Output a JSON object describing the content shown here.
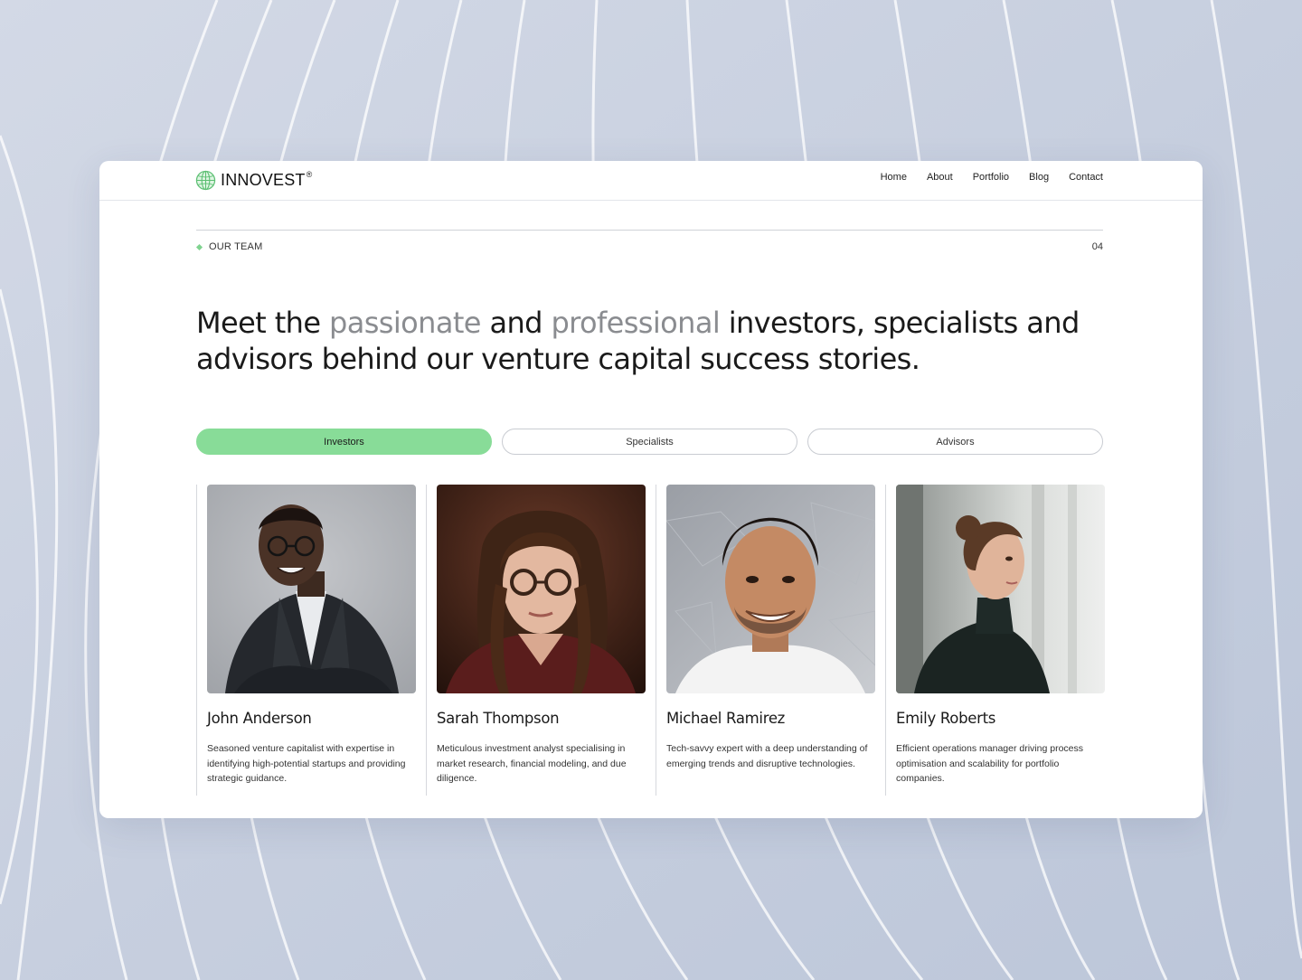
{
  "brand": {
    "name": "INNOVEST",
    "mark": "®",
    "accent_color": "#88dc98",
    "logo_icon": "globe-icon"
  },
  "nav": {
    "items": [
      "Home",
      "About",
      "Portfolio",
      "Blog",
      "Contact"
    ]
  },
  "section": {
    "label": "OUR TEAM",
    "number": "04"
  },
  "headline": {
    "part1": "Meet the ",
    "highlight1": "passionate",
    "part2": " and ",
    "highlight2": "professional",
    "part3": " investors, specialists and advisors behind our venture capital success stories."
  },
  "tabs": [
    {
      "label": "Investors",
      "active": true
    },
    {
      "label": "Specialists",
      "active": false
    },
    {
      "label": "Advisors",
      "active": false
    }
  ],
  "team": [
    {
      "name": "John Anderson",
      "bio": "Seasoned venture capitalist with expertise in identifying high-potential startups and providing strategic guidance."
    },
    {
      "name": "Sarah Thompson",
      "bio": "Meticulous investment analyst specialising in market research, financial modeling, and due diligence."
    },
    {
      "name": "Michael Ramirez",
      "bio": "Tech-savvy expert with a deep understanding of emerging trends and disruptive technologies."
    },
    {
      "name": "Emily Roberts",
      "bio": "Efficient operations manager driving process optimisation and scalability for portfolio companies."
    }
  ]
}
